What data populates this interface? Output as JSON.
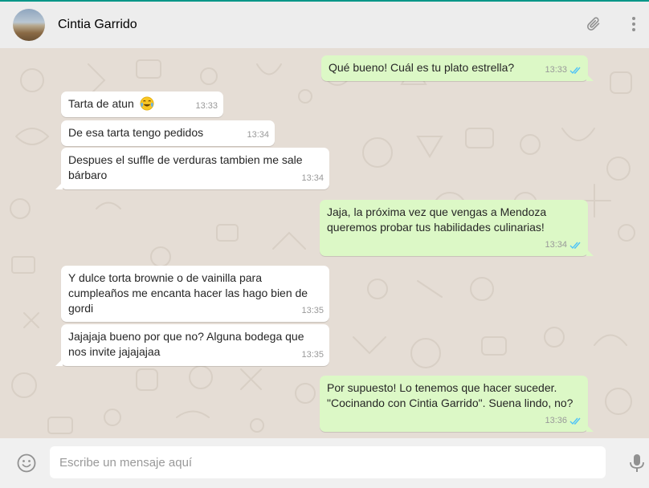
{
  "header": {
    "contact_name": "Cintia Garrido",
    "avatar_icon": "contact-avatar-photo",
    "attach_icon": "paperclip-icon",
    "menu_icon": "more-vertical-icon"
  },
  "messages": [
    {
      "direction": "out",
      "text": "Qué bueno! Cuál es tu plato estrella?",
      "time": "13:33",
      "status": "read"
    },
    {
      "direction": "in",
      "text": "Tarta de atun",
      "emoji": "laughing-tears-emoji",
      "time": "13:33"
    },
    {
      "direction": "in",
      "text": "De esa tarta tengo pedidos",
      "time": "13:34"
    },
    {
      "direction": "in",
      "text_lines": [
        "Despues el suffle de verduras tambien me sale",
        "bárbaro"
      ],
      "time": "13:34"
    },
    {
      "direction": "out",
      "text_lines": [
        "Jaja, la próxima vez que vengas a Mendoza",
        "queremos probar tus habilidades culinarias!"
      ],
      "time": "13:34",
      "status": "read"
    },
    {
      "direction": "in",
      "text_lines": [
        "Y dulce torta brownie o de vainilla para",
        "cumpleaños me encanta hacer las hago bien de",
        "gordi"
      ],
      "time": "13:35"
    },
    {
      "direction": "in",
      "text_lines": [
        "Jajajaja bueno por que no? Alguna bodega que",
        "nos invite jajajajaa"
      ],
      "time": "13:35"
    },
    {
      "direction": "out",
      "text_lines": [
        "Por supuesto! Lo tenemos que hacer suceder.",
        "\"Cocinando con Cintia Garrido\". Suena lindo, no?"
      ],
      "time": "13:36",
      "status": "read"
    }
  ],
  "composer": {
    "placeholder": "Escribe un mensaje aquí",
    "value": "",
    "emoji_icon": "smiley-icon",
    "mic_icon": "microphone-icon"
  },
  "colors": {
    "incoming_bubble": "#ffffff",
    "outgoing_bubble": "#dcf8c6",
    "chat_background": "#e5ddd5",
    "read_ticks": "#4fc3f7",
    "header_accent": "#009688"
  }
}
